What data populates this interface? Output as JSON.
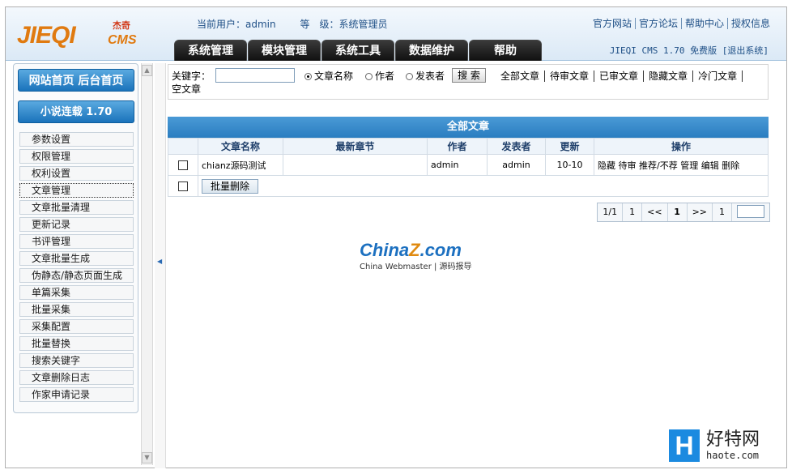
{
  "header": {
    "logo_text": "JIEQI",
    "logo_sub": "CMS",
    "logo_cn": "杰奇",
    "current_user": "当前用户：admin",
    "user_level": "等　级：系统管理员",
    "top_links": [
      "官方网站",
      "官方论坛",
      "帮助中心",
      "授权信息"
    ],
    "version": "JIEQI CMS 1.70 免费版",
    "logout": "[退出系统]",
    "tabs": [
      "系统管理",
      "模块管理",
      "系统工具",
      "数据维护",
      "帮助"
    ]
  },
  "sidebar": {
    "home_button": "网站首页 后台首页",
    "section_title": "小说连载 1.70",
    "items": [
      {
        "label": "参数设置"
      },
      {
        "label": "权限管理"
      },
      {
        "label": "权利设置"
      },
      {
        "label": "文章管理"
      },
      {
        "label": "文章批量清理"
      },
      {
        "label": "更新记录"
      },
      {
        "label": "书评管理"
      },
      {
        "label": "文章批量生成"
      },
      {
        "label": "伪静态/静态页面生成"
      },
      {
        "label": "单篇采集"
      },
      {
        "label": "批量采集"
      },
      {
        "label": "采集配置"
      },
      {
        "label": "批量替换"
      },
      {
        "label": "搜索关键字"
      },
      {
        "label": "文章删除日志"
      },
      {
        "label": "作家申请记录"
      }
    ],
    "active_index": 3
  },
  "search": {
    "keyword_label": "关键字：",
    "keyword_value": "",
    "radios": [
      "文章名称",
      "作者",
      "发表者"
    ],
    "selected_radio": 0,
    "button": "搜 索",
    "filters": [
      "全部文章",
      "待审文章",
      "已审文章",
      "隐藏文章",
      "冷门文章"
    ],
    "filters_line2": "空文章"
  },
  "table": {
    "title": "全部文章",
    "columns": [
      "",
      "文章名称",
      "最新章节",
      "作者",
      "发表者",
      "更新",
      "操作"
    ],
    "rows": [
      {
        "name": "chianz源码测试",
        "latest": "",
        "author": "admin",
        "poster": "admin",
        "updated": "10-10",
        "actions": "隐藏 待审 推荐/不荐 管理 编辑 删除"
      }
    ],
    "batch_delete": "批量删除"
  },
  "pager": [
    "1/1",
    "1",
    "<<",
    "1",
    ">>",
    "1"
  ],
  "watermark": {
    "main": "China",
    "z": "Z",
    "com": ".com",
    "sub": "China Webmaster | 源码报导"
  },
  "corner_logo": {
    "letter": "H",
    "cn": "好特网",
    "url": "haote.com"
  }
}
